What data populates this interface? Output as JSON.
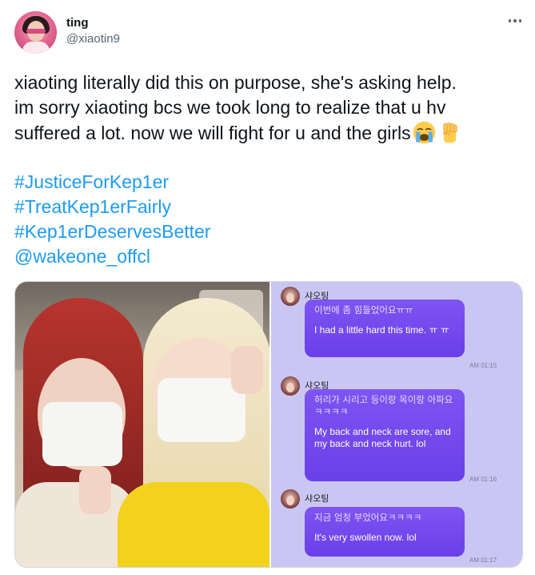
{
  "user": {
    "display_name": "ting",
    "handle": "@xiaotin9",
    "avatar_icon": "profile-photo"
  },
  "more_icon": "more-horizontal-icon",
  "tweet": {
    "lines": [
      "xiaoting literally did this on purpose, she's asking help.",
      "im sorry xiaoting bcs we took long to realize that u hv",
      "suffered a lot. now we will fight for u and the girls"
    ],
    "emojis": [
      "loudly-crying-face-emoji",
      "raised-fist-emoji"
    ],
    "hashtags": [
      "#JusticeForKep1er",
      "#TreatKep1erFairly",
      "#Kep1erDeservesBetter"
    ],
    "mention": "@wakeone_offcl"
  },
  "media": {
    "photo_icon": "selfie-photo",
    "chat": {
      "sender": "샤오팅",
      "messages": [
        {
          "korean": "이번에 좀 힘들었어요ㅠㅠ",
          "english": "I had a little hard this time. ㅠ ㅠ",
          "time": "AM 01:15"
        },
        {
          "korean": "허리가 시리고 등이랑 목이랑 아파요ㅋㅋㅋㅋ",
          "english": "My back and neck are sore, and my back and neck hurt. lol",
          "time": "AM 01:16"
        },
        {
          "korean": "지금 엄청 부었어요ㅋㅋㅋㅋ",
          "english": "It's very swollen now. lol",
          "time": "AM 01:17"
        }
      ]
    }
  }
}
